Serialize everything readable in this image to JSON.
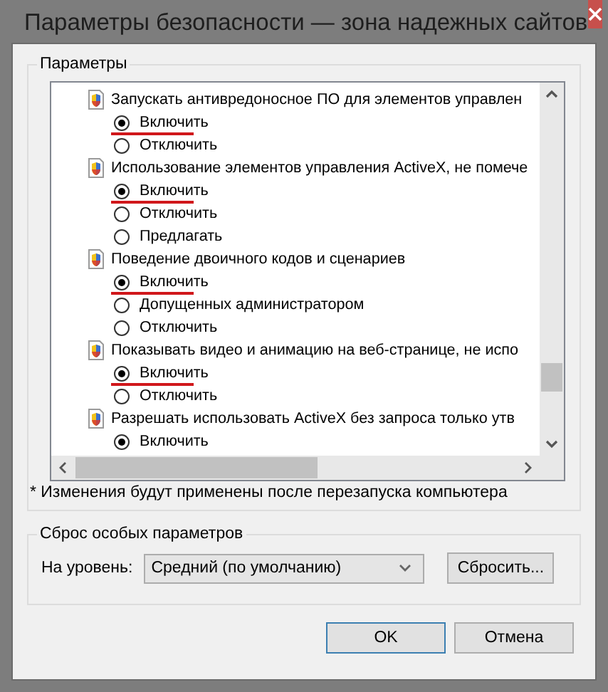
{
  "window": {
    "title": "Параметры безопасности — зона надежных сайтов"
  },
  "settings_group": {
    "title": "Параметры",
    "items": [
      {
        "label": "Запускать антивредоносное ПО для элементов управлен",
        "options": [
          {
            "label": "Включить",
            "selected": true,
            "marked": true
          },
          {
            "label": "Отключить",
            "selected": false,
            "marked": false
          }
        ]
      },
      {
        "label": "Использование элементов управления ActiveX, не помече",
        "options": [
          {
            "label": "Включить",
            "selected": true,
            "marked": true
          },
          {
            "label": "Отключить",
            "selected": false,
            "marked": false
          },
          {
            "label": "Предлагать",
            "selected": false,
            "marked": false
          }
        ]
      },
      {
        "label": "Поведение двоичного кодов и сценариев",
        "options": [
          {
            "label": "Включить",
            "selected": true,
            "marked": true
          },
          {
            "label": "Допущенных администратором",
            "selected": false,
            "marked": false
          },
          {
            "label": "Отключить",
            "selected": false,
            "marked": false
          }
        ]
      },
      {
        "label": "Показывать видео и анимацию на веб-странице, не испо",
        "options": [
          {
            "label": "Включить",
            "selected": true,
            "marked": true
          },
          {
            "label": "Отключить",
            "selected": false,
            "marked": false
          }
        ]
      },
      {
        "label": "Разрешать использовать ActiveX без запроса только утв",
        "options": [
          {
            "label": "Включить",
            "selected": true,
            "marked": false
          }
        ]
      }
    ],
    "note": "* Изменения будут применены после перезапуска компьютера"
  },
  "reset_group": {
    "title": "Сброс особых параметров",
    "level_label": "На уровень:",
    "level_value": "Средний (по умолчанию)",
    "reset_button": "Сбросить..."
  },
  "buttons": [
    {
      "label": "OK",
      "default": true
    },
    {
      "label": "Отмена",
      "default": false
    }
  ]
}
